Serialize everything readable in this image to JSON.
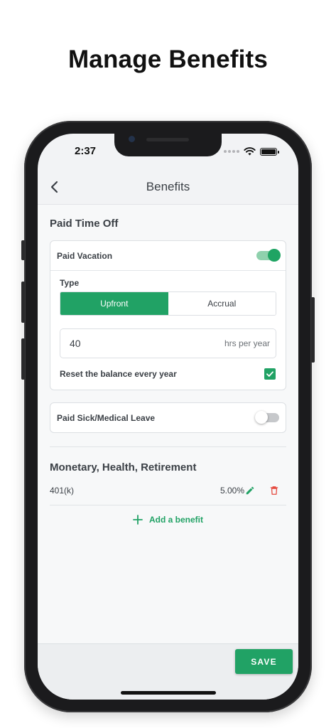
{
  "hero": {
    "title": "Manage Benefits"
  },
  "status_bar": {
    "time": "2:37"
  },
  "nav": {
    "title": "Benefits"
  },
  "paid_time_off": {
    "section_title": "Paid Time Off",
    "paid_vacation": {
      "label": "Paid Vacation",
      "enabled": true,
      "type_label": "Type",
      "type_options": [
        "Upfront",
        "Accrual"
      ],
      "selected_type": "Upfront",
      "hours_value": "40",
      "hours_unit": "hrs per year",
      "reset_label": "Reset the balance every year",
      "reset_checked": true
    },
    "paid_sick": {
      "label": "Paid Sick/Medical Leave",
      "enabled": false
    }
  },
  "monetary": {
    "section_title": "Monetary, Health, Retirement",
    "items": [
      {
        "name": "401(k)",
        "value": "5.00%"
      }
    ],
    "add_label": "Add a benefit"
  },
  "footer": {
    "save_label": "SAVE"
  },
  "colors": {
    "accent": "#21a265",
    "toggle_track_on": "#8fd1ad",
    "delete": "#e5483d",
    "background": "#f7f8f9"
  },
  "icons": {
    "back": "chevron-left-icon",
    "edit": "pencil-icon",
    "delete": "trash-icon",
    "add": "plus-icon",
    "check": "check-icon",
    "wifi": "wifi-icon",
    "battery": "battery-icon"
  }
}
